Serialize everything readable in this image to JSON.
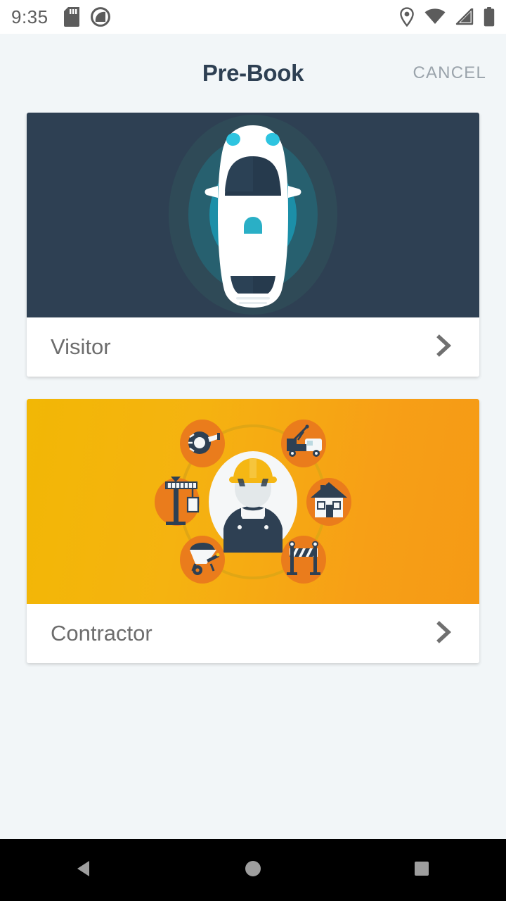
{
  "status_bar": {
    "time": "9:35",
    "left_icons": [
      "sd-card-icon",
      "do-not-disturb-icon"
    ],
    "right_icons": [
      "location-icon",
      "wifi-icon",
      "cellular-signal-icon",
      "battery-icon"
    ],
    "icon_color": "#5c5c5c",
    "background": "#ffffff"
  },
  "header": {
    "title": "Pre-Book",
    "title_color": "#2e4053",
    "cancel_label": "CANCEL",
    "cancel_color": "#9aa3ab"
  },
  "page": {
    "background": "#f2f6f8"
  },
  "cards": [
    {
      "id": "visitor",
      "label": "Visitor",
      "label_color": "#6d6d6d",
      "art_name": "car-top-view-illustration",
      "art_background": "#2e4053",
      "art_colors": {
        "ring_outer": "#2f4a57",
        "ring_mid": "#1f6476",
        "ring_inner": "#23b5d3",
        "car_body": "#ffffff",
        "car_glass": "#263a4d",
        "headlight": "#2ec4e0"
      },
      "chevron_icon": "chevron-right-icon"
    },
    {
      "id": "contractor",
      "label": "Contractor",
      "label_color": "#6d6d6d",
      "art_name": "contractor-trades-illustration",
      "art_background_start": "#f2b705",
      "art_background_end": "#f59a15",
      "art_colors": {
        "badge": "#ea7c1c",
        "ring_line": "#e0a615",
        "avatar_bg": "#f5f7f8",
        "helmet": "#f5b714",
        "overalls": "#2e4053",
        "icon_dark": "#2e4053"
      },
      "orbit_icons": [
        "tape-measure-icon",
        "crane-truck-icon",
        "house-icon",
        "road-barrier-icon",
        "wheelbarrow-icon",
        "tower-crane-icon"
      ],
      "center_icon": "construction-worker-avatar",
      "chevron_icon": "chevron-right-icon"
    }
  ],
  "nav_bar": {
    "background": "#000000",
    "icon_color": "#9e9e9e",
    "buttons": [
      "back-button",
      "home-button",
      "recents-button"
    ]
  }
}
